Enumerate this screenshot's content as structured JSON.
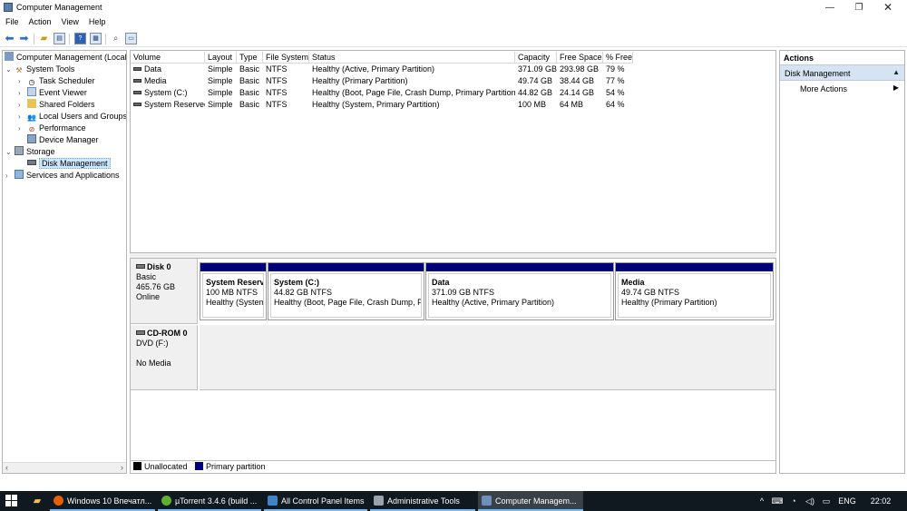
{
  "window": {
    "title": "Computer Management"
  },
  "menu": {
    "items": [
      "File",
      "Action",
      "View",
      "Help"
    ]
  },
  "toolbar": {
    "buttons": [
      "back-icon",
      "forward-icon",
      "up-folder-icon",
      "show-hide-tree-icon",
      "help-icon",
      "properties-icon",
      "connect-icon",
      "view-icon"
    ]
  },
  "tree": {
    "items": [
      {
        "label": "Computer Management (Local",
        "icon": "computer-icon",
        "expander": ""
      },
      {
        "label": "System Tools",
        "icon": "tools-icon",
        "expander": "v"
      },
      {
        "label": "Task Scheduler",
        "icon": "clock-icon",
        "expander": ">"
      },
      {
        "label": "Event Viewer",
        "icon": "event-viewer-icon",
        "expander": ">"
      },
      {
        "label": "Shared Folders",
        "icon": "shared-folder-icon",
        "expander": ">"
      },
      {
        "label": "Local Users and Groups",
        "icon": "users-icon",
        "expander": ">"
      },
      {
        "label": "Performance",
        "icon": "performance-icon",
        "expander": ">"
      },
      {
        "label": "Device Manager",
        "icon": "device-manager-icon",
        "expander": ""
      },
      {
        "label": "Storage",
        "icon": "storage-icon",
        "expander": "v"
      },
      {
        "label": "Disk Management",
        "icon": "disk-management-icon",
        "expander": ""
      },
      {
        "label": "Services and Applications",
        "icon": "services-icon",
        "expander": ">"
      }
    ]
  },
  "volumes": {
    "headers": [
      "Volume",
      "Layout",
      "Type",
      "File System",
      "Status",
      "Capacity",
      "Free Space",
      "% Free"
    ],
    "rows": [
      [
        "Data",
        "Simple",
        "Basic",
        "NTFS",
        "Healthy (Active, Primary Partition)",
        "371.09 GB",
        "293.98 GB",
        "79 %"
      ],
      [
        "Media",
        "Simple",
        "Basic",
        "NTFS",
        "Healthy (Primary Partition)",
        "49.74 GB",
        "38.44 GB",
        "77 %"
      ],
      [
        "System (C:)",
        "Simple",
        "Basic",
        "NTFS",
        "Healthy (Boot, Page File, Crash Dump, Primary Partition)",
        "44.82 GB",
        "24.14 GB",
        "54 %"
      ],
      [
        "System Reserved",
        "Simple",
        "Basic",
        "NTFS",
        "Healthy (System, Primary Partition)",
        "100 MB",
        "64 MB",
        "64 %"
      ]
    ]
  },
  "disks": {
    "disk0": {
      "name": "Disk 0",
      "type": "Basic",
      "size": "465.76 GB",
      "state": "Online"
    },
    "partitions": [
      {
        "name": "System Reserve",
        "size": "100 MB NTFS",
        "status": "Healthy (System"
      },
      {
        "name": "System  (C:)",
        "size": "44.82 GB NTFS",
        "status": "Healthy (Boot, Page File, Crash Dump, Prir"
      },
      {
        "name": "Data",
        "size": "371.09 GB NTFS",
        "status": "Healthy (Active, Primary Partition)"
      },
      {
        "name": "Media",
        "size": "49.74 GB NTFS",
        "status": "Healthy (Primary Partition)"
      }
    ],
    "cdrom": {
      "name": "CD-ROM 0",
      "drive": "DVD (F:)",
      "media": "No Media"
    }
  },
  "legend": {
    "unallocated": "Unallocated",
    "primary": "Primary partition",
    "unallocated_color": "#000000",
    "primary_color": "#00007f"
  },
  "actions": {
    "header": "Actions",
    "section": "Disk Management",
    "more": "More Actions"
  },
  "taskbar": {
    "tasks": [
      {
        "label": "Windows 10 Впечатл...",
        "icon": "firefox-icon"
      },
      {
        "label": "µTorrent 3.4.6  (build ...",
        "icon": "utorrent-icon"
      },
      {
        "label": "All Control Panel Items",
        "icon": "control-panel-icon"
      },
      {
        "label": "Administrative Tools",
        "icon": "admin-tools-icon"
      },
      {
        "label": "Computer Managem...",
        "icon": "computer-management-icon"
      }
    ],
    "language": "ENG",
    "time": "22:02"
  }
}
